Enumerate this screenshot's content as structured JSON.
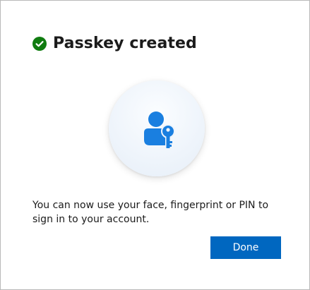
{
  "dialog": {
    "title": "Passkey created",
    "title_icon": "check-circle-icon",
    "hero_icon": "person-key-icon",
    "message": "You can now use your face, fingerprint or PIN to sign in to your account.",
    "done_label": "Done"
  },
  "colors": {
    "success": "#107c10",
    "accent": "#0067c0",
    "icon_blue": "#1a7fe0",
    "text": "#1b1b1b"
  }
}
